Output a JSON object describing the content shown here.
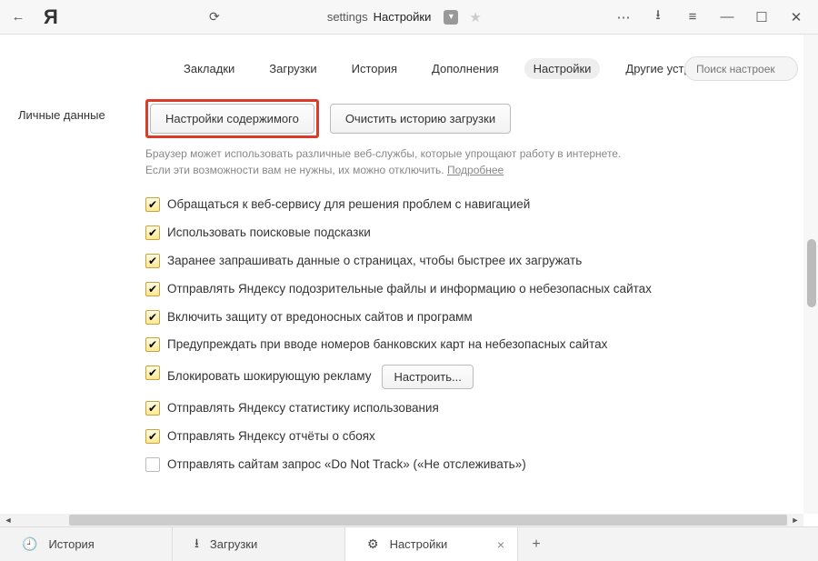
{
  "titlebar": {
    "address_prefix": "settings",
    "address_title": "Настройки"
  },
  "tabs": {
    "items": [
      "Закладки",
      "Загрузки",
      "История",
      "Дополнения",
      "Настройки",
      "Другие устройства"
    ],
    "active_index": 4,
    "search_placeholder": "Поиск настроек"
  },
  "section": {
    "label": "Личные данные",
    "btn_content": "Настройки содержимого",
    "btn_clear": "Очистить историю загрузки",
    "help1": "Браузер может использовать различные веб-службы, которые упрощают работу в интернете.",
    "help2": "Если эти возможности вам не нужны, их можно отключить.",
    "help_link": "Подробнее",
    "checks": [
      {
        "checked": true,
        "label": "Обращаться к веб-сервису для решения проблем с навигацией"
      },
      {
        "checked": true,
        "label": "Использовать поисковые подсказки"
      },
      {
        "checked": true,
        "label": "Заранее запрашивать данные о страницах, чтобы быстрее их загружать"
      },
      {
        "checked": true,
        "label": "Отправлять Яндексу подозрительные файлы и информацию о небезопасных сайтах"
      },
      {
        "checked": true,
        "label": "Включить защиту от вредоносных сайтов и программ"
      },
      {
        "checked": true,
        "label": "Предупреждать при вводе номеров банковских карт на небезопасных сайтах"
      },
      {
        "checked": true,
        "label": "Блокировать шокирующую рекламу",
        "button": "Настроить..."
      },
      {
        "checked": true,
        "label": "Отправлять Яндексу статистику использования"
      },
      {
        "checked": true,
        "label": "Отправлять Яндексу отчёты о сбоях"
      },
      {
        "checked": false,
        "label": "Отправлять сайтам запрос «Do Not Track» («Не отслеживать»)"
      }
    ]
  },
  "tabstrip": {
    "items": [
      {
        "icon": "clock",
        "label": "История"
      },
      {
        "icon": "download",
        "label": "Загрузки"
      },
      {
        "icon": "gear",
        "label": "Настройки",
        "active": true,
        "closeable": true
      }
    ]
  }
}
